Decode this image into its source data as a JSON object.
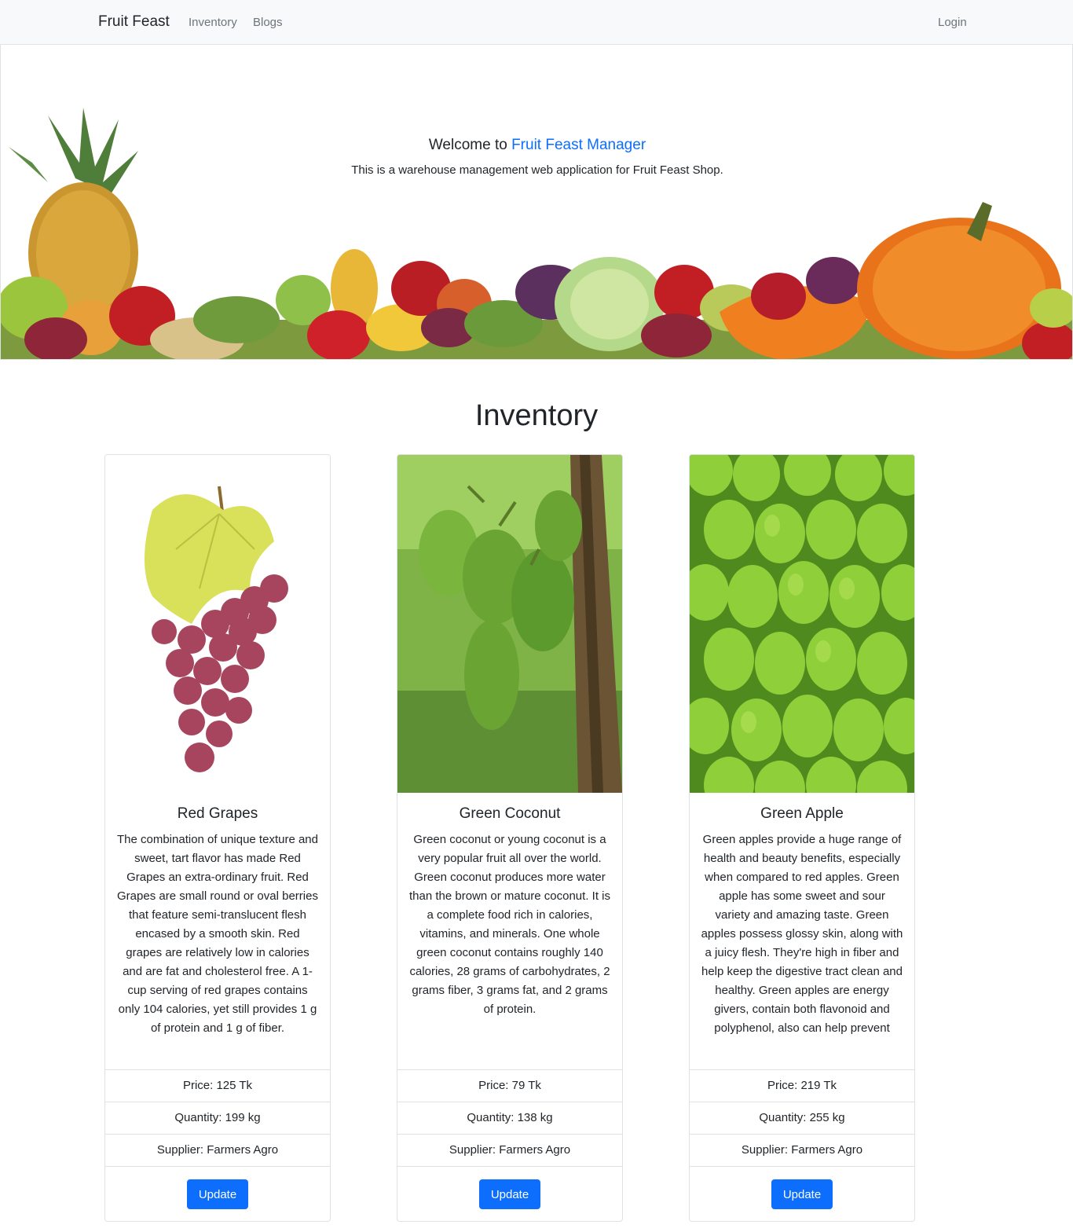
{
  "nav": {
    "brand": "Fruit Feast",
    "links": [
      "Inventory",
      "Blogs"
    ],
    "login": "Login"
  },
  "hero": {
    "title_prefix": "Welcome to ",
    "title_accent": "Fruit Feast Manager",
    "subtitle": "This is a warehouse management web application for Fruit Feast Shop."
  },
  "inventory": {
    "title": "Inventory",
    "items": [
      {
        "name": "Red Grapes",
        "description": "The combination of unique texture and sweet, tart flavor has made Red Grapes an extra-ordinary fruit. Red Grapes are small round or oval berries that feature semi-translucent flesh encased by a smooth skin. Red grapes are relatively low in calories and are fat and cholesterol free. A 1-cup serving of red grapes contains only 104 calories, yet still provides 1 g of protein and 1 g of fiber.",
        "price": "Price: 125 Tk",
        "quantity": "Quantity: 199 kg",
        "supplier": "Supplier: Farmers Agro",
        "button": "Update"
      },
      {
        "name": "Green Coconut",
        "description": "Green coconut or young coconut is a very popular fruit all over the world. Green coconut produces more water than the brown or mature coconut. It is a complete food rich in calories, vitamins, and minerals. One whole green coconut contains roughly 140 calories, 28 grams of carbohydrates, 2 grams fiber, 3 grams fat, and 2 grams of protein.",
        "price": "Price: 79 Tk",
        "quantity": "Quantity: 138 kg",
        "supplier": "Supplier: Farmers Agro",
        "button": "Update"
      },
      {
        "name": "Green Apple",
        "description": "Green apples provide a huge range of health and beauty benefits, especially when compared to red apples. Green apple has some sweet and sour variety and amazing taste. Green apples possess glossy skin, along with a juicy flesh. They're high in fiber and help keep the digestive tract clean and healthy. Green apples are energy givers, contain both flavonoid and polyphenol, also can help prevent",
        "price": "Price: 219 Tk",
        "quantity": "Quantity: 255 kg",
        "supplier": "Supplier: Farmers Agro",
        "button": "Update"
      }
    ]
  },
  "colors": {
    "accent": "#0d6efd",
    "navbar_bg": "#f8f9fa",
    "border": "#dee2e6",
    "text": "#212529",
    "muted": "#6c757d"
  },
  "images": {
    "hero": "fruit-vegetable-banner",
    "cards": [
      "red-grapes-photo",
      "green-coconut-photo",
      "green-apple-photo"
    ]
  }
}
